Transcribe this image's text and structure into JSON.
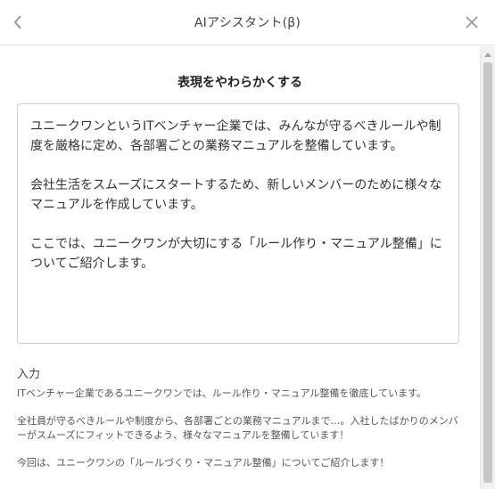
{
  "header": {
    "title": "AIアシスタント(β)",
    "back_icon": "chevron-left-icon",
    "close_icon": "close-icon"
  },
  "section_title": "表現をやわらかくする",
  "output": {
    "paragraphs": [
      "ユニークワンというITベンチャー企業では、みんなが守るべきルールや制度を厳格に定め、各部署ごとの業務マニュアルを整備しています。",
      "会社生活をスムーズにスタートするため、新しいメンバーのために様々なマニュアルを作成しています。",
      "ここでは、ユニークワンが大切にする「ルール作り・マニュアル整備」についてご紹介します。"
    ]
  },
  "input": {
    "label": "入力",
    "paragraphs": [
      "ITベンチャー企業であるユニークワンでは、ルール作り・マニュアル整備を徹底しています。",
      "全社員が守るべきルールや制度から、各部署ごとの業務マニュアルまで…。入社したばかりのメンバーがスムーズにフィットできるよう、様々なマニュアルを整備しています！",
      "今回は、ユニークワンの「ルールづくり・マニュアル整備」についてご紹介します！"
    ]
  },
  "colors": {
    "border": "#cfcfcf",
    "header_border": "#e2e2e2",
    "text": "#333333",
    "scroll_thumb": "#c7c7c7"
  }
}
